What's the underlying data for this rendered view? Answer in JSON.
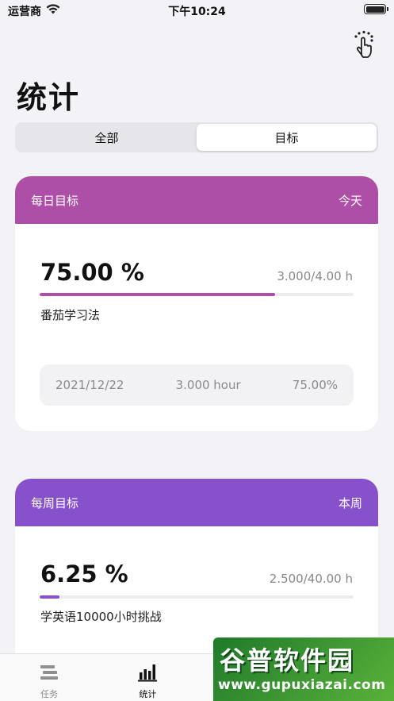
{
  "status_bar": {
    "carrier": "运营商",
    "time": "下午10:24"
  },
  "header": {
    "title": "统计"
  },
  "segmented": {
    "all_label": "全部",
    "goals_label": "目标",
    "selected": "目标"
  },
  "cards": [
    {
      "header_title": "每日目标",
      "period": "今天",
      "percent": "75.00 %",
      "ratio": "3.000/4.00 h",
      "progress": 0.75,
      "goal_name": "番茄学习法",
      "record": {
        "date": "2021/12/22",
        "duration": "3.000 hour",
        "percent": "75.00%"
      },
      "color": "#ad4fa6"
    },
    {
      "header_title": "每周目标",
      "period": "本周",
      "percent": "6.25 %",
      "ratio": "2.500/40.00 h",
      "progress": 0.0625,
      "goal_name": "学英语10000小时挑战",
      "color": "#8751cc"
    }
  ],
  "tab_bar": {
    "tasks_label": "任务",
    "stats_label": "统计",
    "active": "统计"
  },
  "watermark": {
    "title": "谷普软件园",
    "url": "www.gupuxiazai.com"
  }
}
